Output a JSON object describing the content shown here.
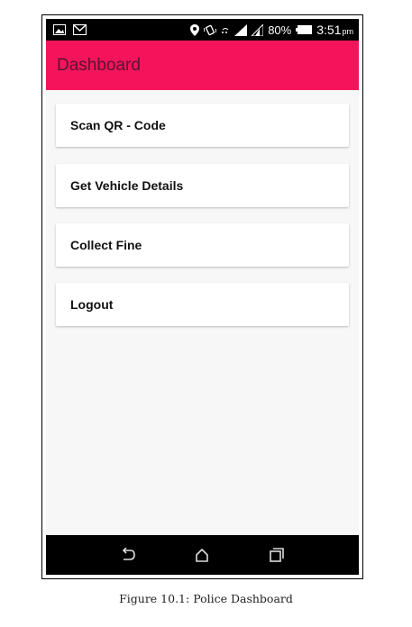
{
  "status_bar": {
    "icons_left": [
      "image-icon",
      "gmail-icon"
    ],
    "icons_right": [
      "location-icon",
      "vibrate-icon",
      "wifi-icon",
      "signal-icon",
      "signal-icon-2",
      "battery-icon"
    ],
    "battery": "80%",
    "time": "3:51",
    "ampm": "pm"
  },
  "app_bar": {
    "title": "Dashboard",
    "color": "#f5145c"
  },
  "menu": {
    "items": [
      {
        "label": "Scan QR - Code"
      },
      {
        "label": "Get Vehicle Details"
      },
      {
        "label": "Collect Fine"
      },
      {
        "label": "Logout"
      }
    ]
  },
  "nav_bar": {
    "buttons": [
      "back-icon",
      "home-icon",
      "recents-icon"
    ]
  },
  "caption": "Figure 10.1: Police Dashboard"
}
